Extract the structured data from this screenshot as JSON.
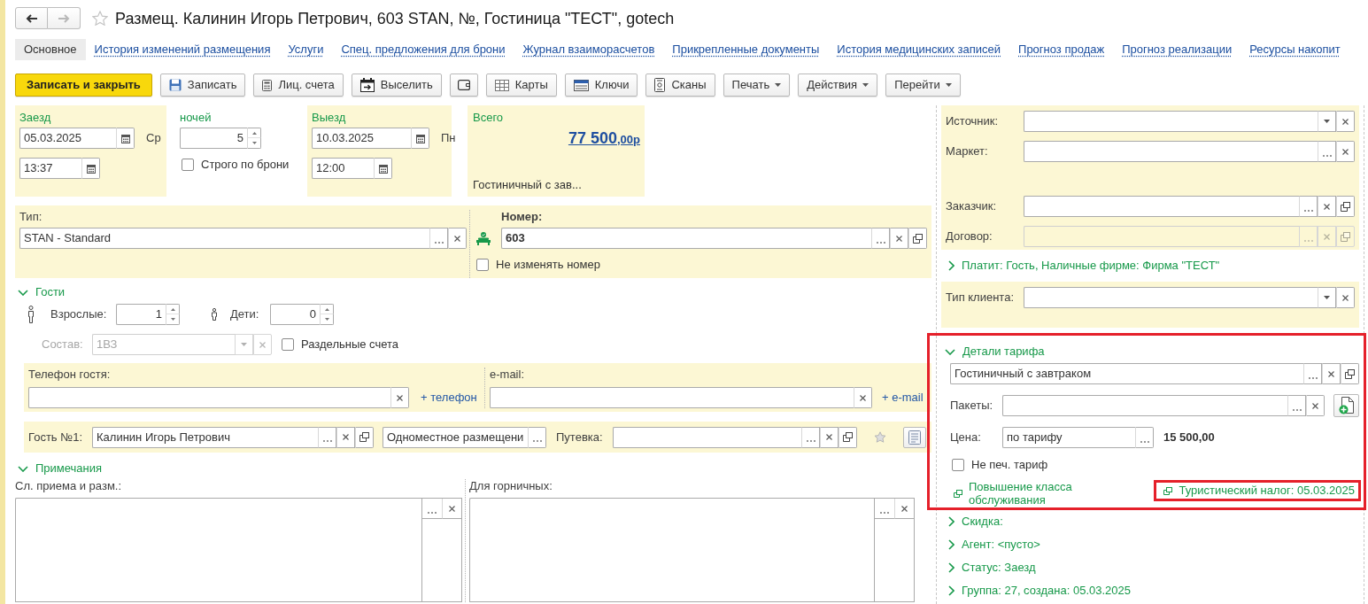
{
  "window": {
    "title": "Размещ. Калинин Игорь Петрович, 603 STAN, №, Гостиница \"ТЕСТ\", gotech"
  },
  "navigation": {
    "back": {
      "disabled": false
    },
    "forward": {
      "disabled": true
    }
  },
  "tabs": [
    {
      "label": "Основное",
      "selected": true
    },
    {
      "label": "История изменений размещения",
      "selected": false
    },
    {
      "label": "Услуги",
      "selected": false
    },
    {
      "label": "Спец. предложения для брони",
      "selected": false
    },
    {
      "label": "Журнал взаиморасчетов",
      "selected": false
    },
    {
      "label": "Прикрепленные документы",
      "selected": false
    },
    {
      "label": "История медицинских записей",
      "selected": false
    },
    {
      "label": "Прогноз продаж",
      "selected": false
    },
    {
      "label": "Прогноз реализации",
      "selected": false
    },
    {
      "label": "Ресурсы накопит",
      "selected": false
    }
  ],
  "toolbar": [
    {
      "kind": "primary",
      "label": "Записать и закрыть"
    },
    {
      "kind": "icon",
      "label": "Записать"
    },
    {
      "kind": "icon",
      "label": "Лиц. счета"
    },
    {
      "kind": "icon",
      "label": "Выселить"
    },
    {
      "kind": "icon"
    },
    {
      "kind": "icon",
      "label": "Карты"
    },
    {
      "kind": "icon",
      "label": "Ключи"
    },
    {
      "kind": "icon",
      "label": "Сканы"
    },
    {
      "kind": "menu",
      "label": "Печать"
    },
    {
      "kind": "menu",
      "label": "Действия"
    },
    {
      "kind": "menu",
      "label": "Перейти"
    }
  ],
  "stay": {
    "arrival": {
      "label": "Заезд",
      "date": "05.03.2025",
      "weekday": "Ср",
      "time": "13:37"
    },
    "nights": {
      "label": "ночей",
      "value": "5",
      "strict": {
        "label": "Строго по брони",
        "checked": false
      }
    },
    "departure": {
      "label": "Выезд",
      "date": "10.03.2025",
      "weekday": "Пн",
      "time": "12:00"
    },
    "total": {
      "label": "Всего",
      "amount": "77 500",
      "fraction": ",00р",
      "rate": "Гостиничный с зав..."
    }
  },
  "room": {
    "type_label": "Тип:",
    "type": "STAN - Standard",
    "number_label": "Номер:",
    "number": "603",
    "keep_number": {
      "label": "Не изменять номер",
      "checked": false
    }
  },
  "guests": {
    "title": "Гости",
    "expanded": true,
    "adults_label": "Взрослые:",
    "adults": "1",
    "children_label": "Дети:",
    "children": "0",
    "composition": {
      "label": "Состав:",
      "value": "1ВЗ",
      "disabled": true
    },
    "separate_accounts": {
      "label": "Раздельные счета",
      "checked": false
    },
    "phone_label": "Телефон гостя:",
    "add_phone": "+ телефон",
    "email_label": "e-mail:",
    "add_email": "+ e-mail",
    "guest_label": "Гость №1:",
    "guest_name": "Калинин Игорь Петрович",
    "accommodation": "Одноместное размещени",
    "voucher_label": "Путевка:"
  },
  "notes": {
    "title": "Примечания",
    "expanded": true,
    "reception_label": "Сл. приема и разм.:",
    "housekeeping_label": "Для горничных:"
  },
  "side": {
    "source_label": "Источник:",
    "market_label": "Маркет:",
    "customer_label": "Заказчик:",
    "contract": {
      "label": "Договор:",
      "disabled": true
    },
    "payer": {
      "title": "Платит: Гость, Наличные фирме: Фирма \"ТЕСТ\"",
      "expanded": false
    },
    "client_type_label": "Тип клиента:",
    "tariff": {
      "title": "Детали тарифа",
      "expanded": true,
      "highlighted": true,
      "rate": "Гостиничный с завтраком",
      "packages_label": "Пакеты:",
      "price_label": "Цена:",
      "price_mode": "по тарифу",
      "price": "15 500,00",
      "no_print": {
        "label": "Не печ. тариф",
        "checked": false
      },
      "upgrade_link": "Повышение класса обслуживания",
      "tax_link": {
        "label": "Туристический налог: 05.03.2025",
        "highlighted": true
      }
    },
    "sections": [
      {
        "title": "Скидка:",
        "expanded": false
      },
      {
        "title": "Агент: <пусто>",
        "expanded": false
      },
      {
        "title": "Статус: Заезд",
        "expanded": false
      },
      {
        "title": "Группа: 27, создана: 05.03.2025",
        "expanded": false
      }
    ]
  }
}
